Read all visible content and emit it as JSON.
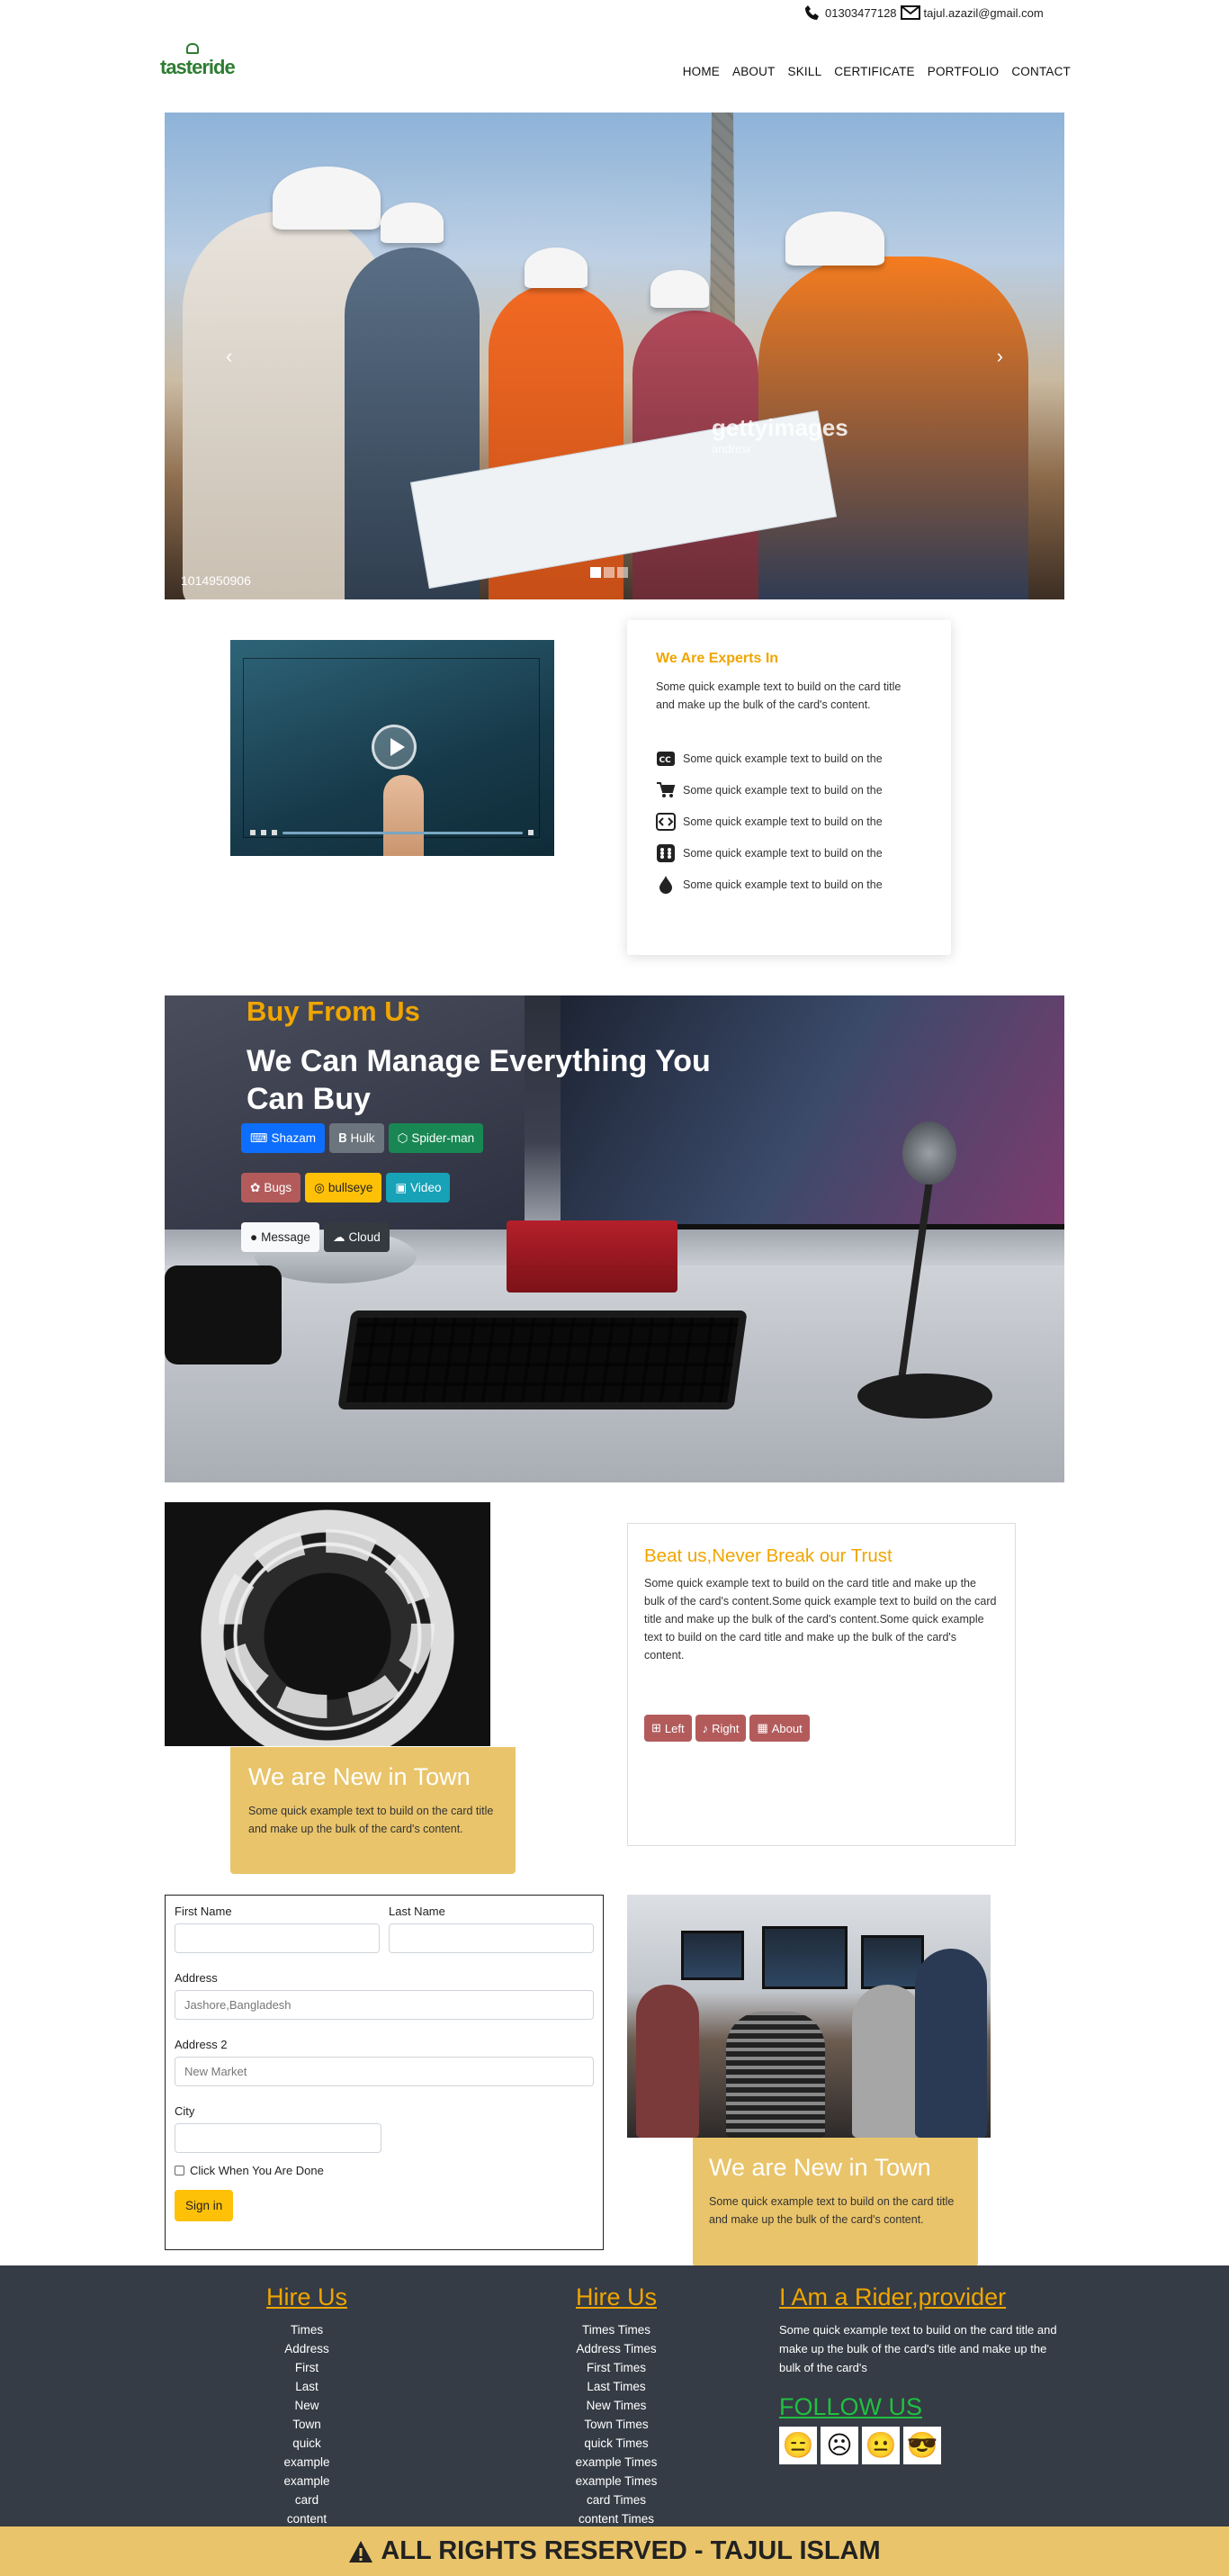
{
  "contact": {
    "phone": "01303477128",
    "email": "tajul.azazil@gmail.com"
  },
  "brand": {
    "logo_text": "tasteride"
  },
  "nav": [
    "HOME",
    "ABOUT",
    "SKILL",
    "CERTIFICATE",
    "PORTFOLIO",
    "CONTACT"
  ],
  "hero": {
    "watermark": "gettyimages",
    "watermark_sub": "andresr",
    "image_id": "1014950906",
    "prev": "‹",
    "next": "›"
  },
  "experts": {
    "title": "We Are Experts In",
    "text": "Some quick example text to build on the card title and make up the bulk of the card's content.",
    "items": [
      {
        "icon": "closed-caption-icon",
        "text": "Some quick example text to build on the"
      },
      {
        "icon": "cart-icon",
        "text": "Some quick example text to build on the"
      },
      {
        "icon": "code-icon",
        "text": "Some quick example text to build on the"
      },
      {
        "icon": "dice-icon",
        "text": "Some quick example text to build on the"
      },
      {
        "icon": "droplet-icon",
        "text": "Some quick example text to build on the"
      }
    ]
  },
  "buy": {
    "eyebrow": "Buy From Us",
    "headline": "We Can Manage Everything You Can Buy",
    "buttons_row1": [
      {
        "label": "Shazam",
        "icon": "keyboard-icon",
        "color": "#0d6efd"
      },
      {
        "label": "Hulk",
        "icon": "bold-icon",
        "color": "#6c757d"
      },
      {
        "label": "Spider-man",
        "icon": "box-icon",
        "color": "#198754"
      }
    ],
    "buttons_row2": [
      {
        "label": "Bugs",
        "icon": "bug-icon",
        "color": "#b35b5b"
      },
      {
        "label": "bullseye",
        "icon": "bullseye-icon",
        "color": "#ffc107"
      },
      {
        "label": "Video",
        "icon": "video-icon",
        "color": "#17a2b8"
      }
    ],
    "buttons_row3": [
      {
        "label": "Message",
        "icon": "chat-icon",
        "color": "#f8f9fa"
      },
      {
        "label": "Cloud",
        "icon": "cloud-upload-icon",
        "color": "#343a40"
      }
    ]
  },
  "newtown1": {
    "title": "We are New in Town",
    "text": "Some quick example text to build on the card title and make up the bulk of the card's content."
  },
  "trust": {
    "title": "Beat us,Never Break our Trust",
    "text": "Some quick example text to build on the card title and make up the bulk of the card's content.Some quick example text to build on the card title and make up the bulk of the card's content.Some quick example text to build on the card title and make up the bulk of the card's content.",
    "buttons": [
      {
        "label": "Left",
        "icon": "plus-square-icon"
      },
      {
        "label": "Right",
        "icon": "bell-icon"
      },
      {
        "label": "About",
        "icon": "calendar-icon"
      }
    ]
  },
  "form": {
    "first_name_label": "First Name",
    "last_name_label": "Last Name",
    "address_label": "Address",
    "address_placeholder": "Jashore,Bangladesh",
    "address2_label": "Address 2",
    "address2_placeholder": "New Market",
    "city_label": "City",
    "check_label": "Click When You Are Done",
    "submit": "Sign in"
  },
  "newtown2": {
    "title": "We are New in Town",
    "text": "Some quick example text to build on the card title and make up the bulk of the card's content."
  },
  "footer": {
    "col1": {
      "title": "Hire Us",
      "items": [
        "Times",
        "Address",
        "First",
        "Last",
        "New",
        "Town",
        "quick",
        "example",
        "example",
        "card",
        "content"
      ]
    },
    "col2": {
      "title": "Hire Us",
      "items": [
        "Times Times",
        "Address Times",
        "First Times",
        "Last Times",
        "New Times",
        "Town Times",
        "quick Times",
        "example Times",
        "example Times",
        "card Times",
        "content Times"
      ]
    },
    "col3": {
      "title": "I Am a Rider,provider",
      "text": "Some quick example text to build on the card title and make up the bulk of the card's title and make up the bulk of the card's"
    },
    "follow": "FOLLOW US",
    "emojis": [
      "😑",
      "☹",
      "😐",
      "😎"
    ]
  },
  "copyright": "ALL RIGHTS RESERVED - TAJUL ISLAM",
  "colors": {
    "accent": "#f0a500",
    "card_yellow": "#e9c46a",
    "footer_bg": "#353c45",
    "follow_green": "#20c040"
  }
}
